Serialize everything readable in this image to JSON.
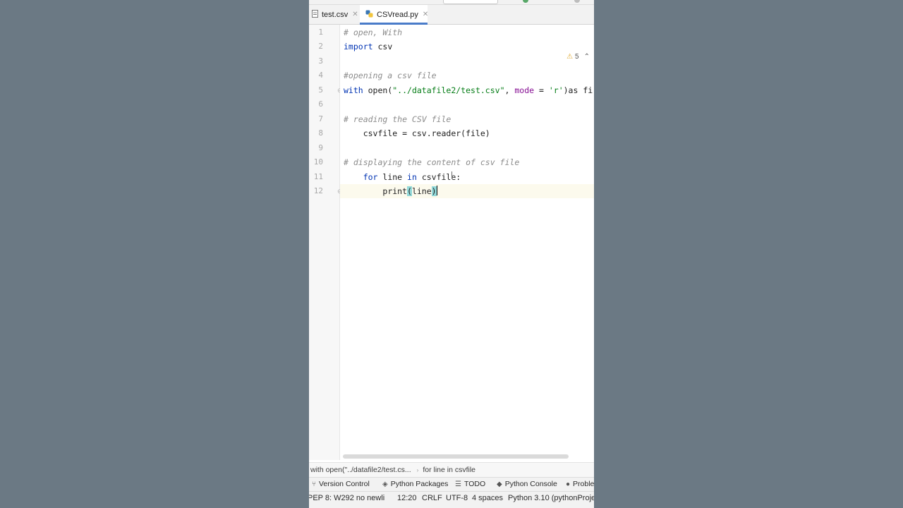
{
  "tabs": [
    {
      "label": "test.csv",
      "icon": "csv-file-icon",
      "active": false
    },
    {
      "label": "CSVread.py",
      "icon": "python-file-icon",
      "active": true
    }
  ],
  "inspection": {
    "warnings": "5"
  },
  "code": {
    "line_numbers": [
      "1",
      "2",
      "3",
      "4",
      "5",
      "6",
      "7",
      "8",
      "9",
      "10",
      "11",
      "12"
    ],
    "l1": "# open, With",
    "l2_kw": "import",
    "l2_rest": " csv",
    "l4": "#opening a csv file",
    "l5_kw": "with",
    "l5_a": " open(",
    "l5_str": "\"../datafile2/test.csv\"",
    "l5_b": ", ",
    "l5_kwarg": "mode",
    "l5_c": " = ",
    "l5_str2": "'r'",
    "l5_d": ")as fi",
    "l7": "# reading the CSV file",
    "l8": "    csvfile = csv.reader(file)",
    "l10": "# displaying the content of csv file",
    "l11_indent": "    ",
    "l11_kw": "for",
    "l11_a": " line ",
    "l11_kw2": "in",
    "l11_b": " csvfile:",
    "l12_indent": "        ",
    "l12_a": "print",
    "l12_lp": "(",
    "l12_b": "line",
    "l12_rp": ")"
  },
  "breadcrumbs": [
    "with open(\"../datafile2/test.cs...",
    "for line in csvfile"
  ],
  "tool_windows": [
    {
      "label": "Version Control",
      "icon": "version-control-icon"
    },
    {
      "label": "Python Packages",
      "icon": "packages-icon"
    },
    {
      "label": "TODO",
      "icon": "todo-icon"
    },
    {
      "label": "Python Console",
      "icon": "python-console-icon"
    },
    {
      "label": "Proble",
      "icon": "problems-icon"
    }
  ],
  "status": {
    "message": "PEP 8: W292 no newli",
    "position": "12:20",
    "line_ending": "CRLF",
    "encoding": "UTF-8",
    "indent": "4 spaces",
    "interpreter": "Python 3.10 (pythonProject"
  },
  "colors": {
    "accent": "#4a7cc9",
    "keyword": "#0033b3",
    "string": "#067d17",
    "comment": "#8c8c8c",
    "backdrop": "#6b7984"
  }
}
